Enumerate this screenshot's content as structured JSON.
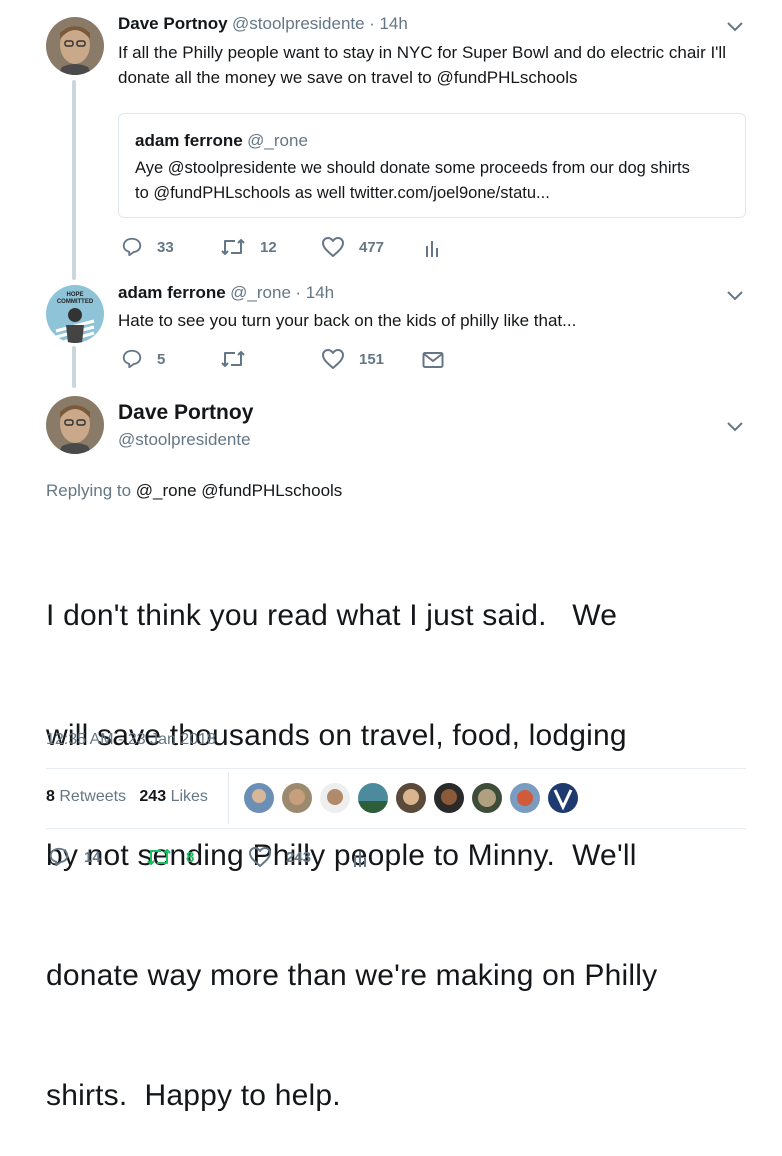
{
  "tweet1": {
    "name": "Dave Portnoy",
    "handle": "@stoolpresidente",
    "time": "· 14h",
    "text_line1": "If all the Philly people want to stay in NYC for Super Bowl and do electric chair I'll",
    "text_line2": "donate all the money we save on travel to @fundPHLschools",
    "quote": {
      "name": "adam ferrone",
      "handle": "@_rone",
      "text_line1": "Aye @stoolpresidente we should donate some proceeds from our dog shirts",
      "text_line2": "to @fundPHLschools as well twitter.com/joel9one/statu..."
    },
    "replies": "33",
    "retweets": "12",
    "likes": "477"
  },
  "tweet2": {
    "name": "adam ferrone",
    "handle": "@_rone",
    "time": "· 14h",
    "avatar_text": "HOPE\nCOMMITTED",
    "text": "Hate to see you turn your back on the kids of philly like that...",
    "replies": "5",
    "retweets": "",
    "likes": "151"
  },
  "main": {
    "name": "Dave Portnoy",
    "handle": "@stoolpresidente",
    "replying_prefix": "Replying to",
    "replying_to": "@_rone @fundPHLschools",
    "text_lines": [
      "I don't think you read what I just said.   We",
      "will save thousands on travel, food, lodging",
      "by not sending Philly people to Minny.  We'll",
      "donate way more than we're making on Philly",
      "shirts.  Happy to help."
    ],
    "timestamp": "12:35 AM - 23 Jan 2018",
    "retweets_count": "8",
    "retweets_label": "Retweets",
    "likes_count": "243",
    "likes_label": "Likes",
    "replies": "14",
    "retweets": "8",
    "likes": "243"
  },
  "colors": {
    "text": "#14171a",
    "muted": "#657786",
    "border": "#e1e8ed",
    "thread": "#ccd6dd",
    "retweeted": "#17bf63"
  }
}
